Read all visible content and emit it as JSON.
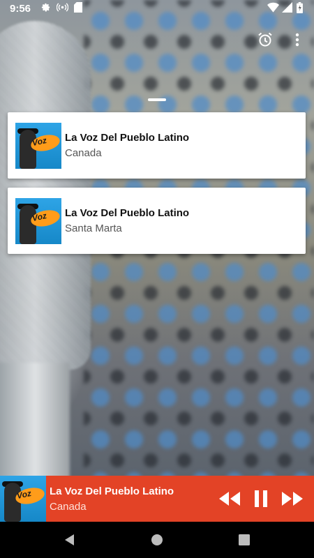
{
  "status_bar": {
    "time": "9:56",
    "left_icons": [
      "settings-icon",
      "radio-broadcast-icon",
      "sd-card-icon"
    ],
    "right_icons": [
      "wifi-icon",
      "cellular-signal-icon",
      "battery-icon"
    ]
  },
  "toolbar": {
    "actions": [
      "alarm-icon",
      "more-vert-icon"
    ]
  },
  "stations": [
    {
      "title": "La Voz Del Pueblo Latino",
      "subtitle": "Canada",
      "logo_text": "Voz"
    },
    {
      "title": "La Voz Del Pueblo Latino",
      "subtitle": "Santa Marta",
      "logo_text": "Voz"
    }
  ],
  "player": {
    "title": "La Voz Del Pueblo Latino",
    "subtitle": "Canada",
    "logo_text": "Voz",
    "background_color": "#e34326",
    "controls": [
      "rewind-icon",
      "pause-icon",
      "fast-forward-icon"
    ]
  },
  "nav_bar": {
    "buttons": [
      "back-icon",
      "home-icon",
      "recents-icon"
    ]
  }
}
